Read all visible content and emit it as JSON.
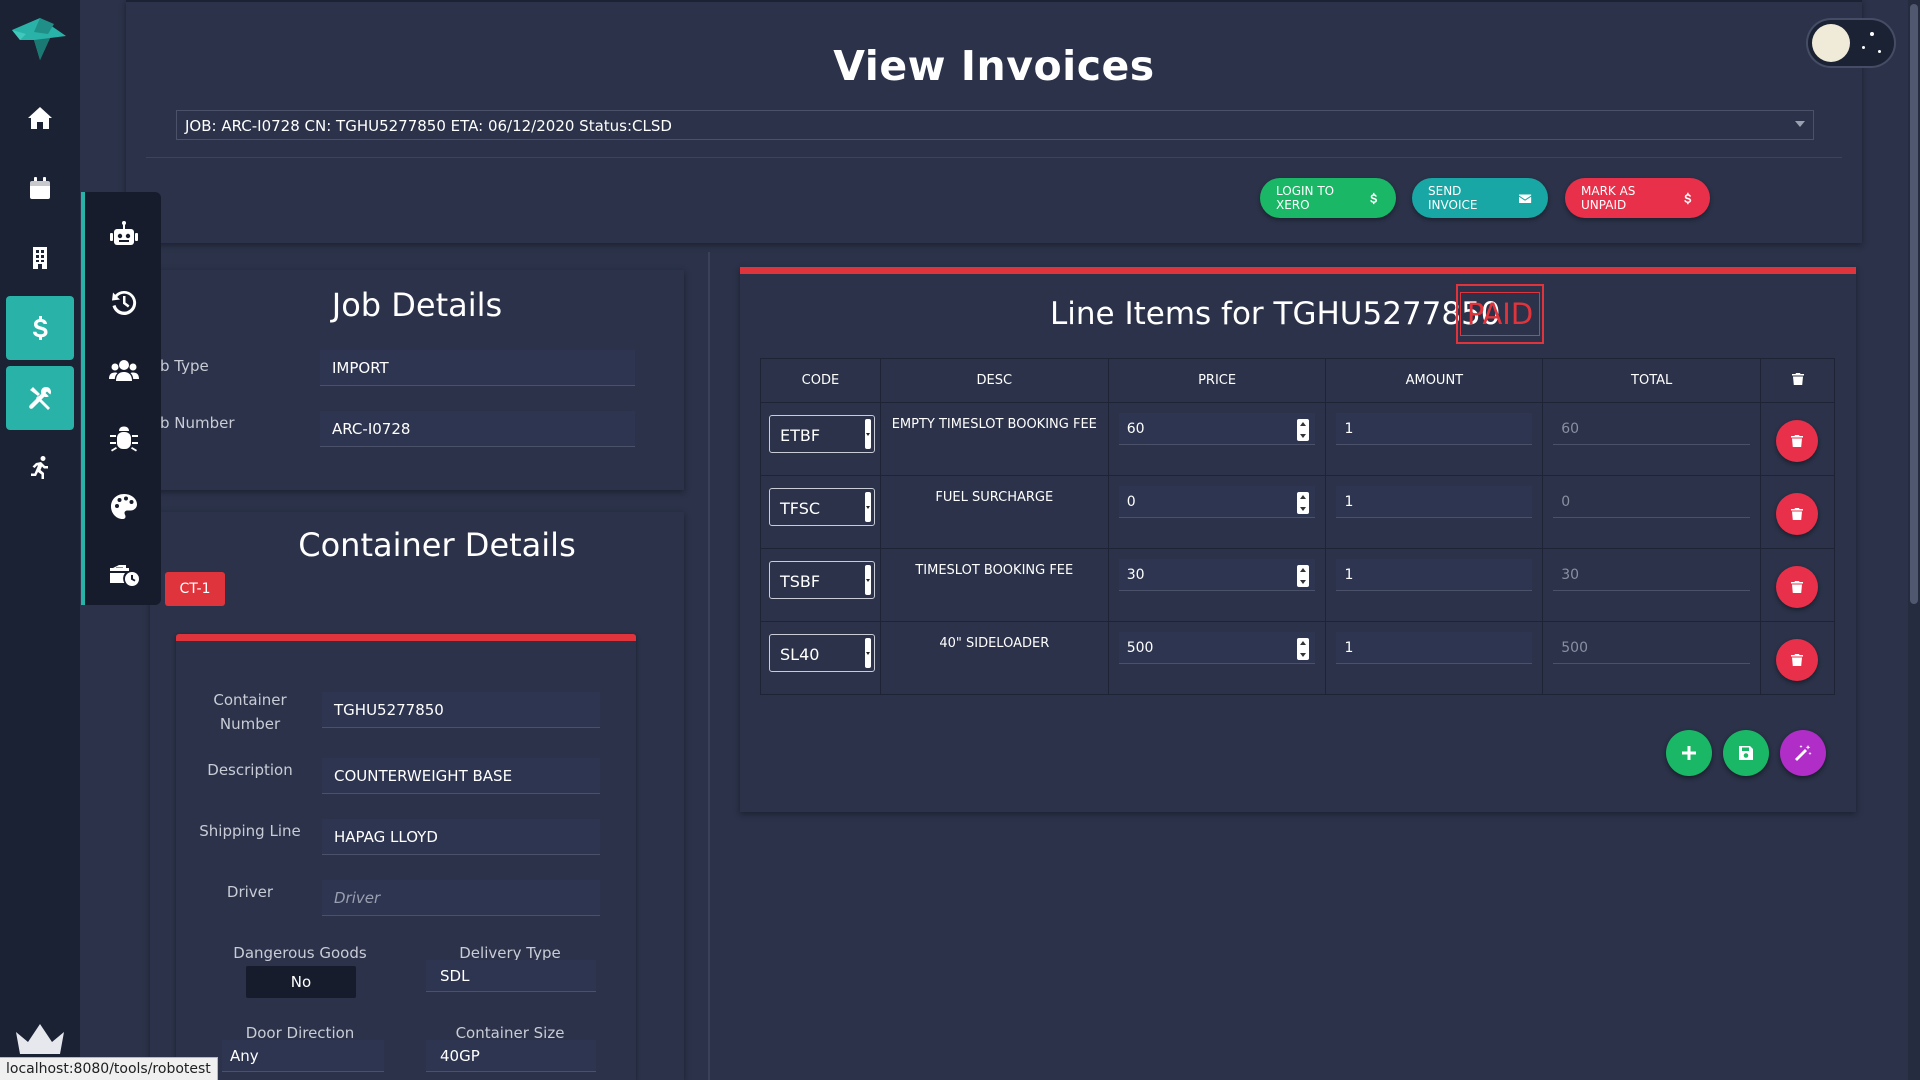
{
  "page": {
    "title": "View Invoices"
  },
  "job_select": {
    "value": "JOB: ARC-I0728 CN: TGHU5277850 ETA: 06/12/2020 Status:CLSD"
  },
  "actions": {
    "login_xero": "LOGIN TO XERO",
    "send_invoice": "SEND INVOICE",
    "mark_unpaid": "MARK AS UNPAID"
  },
  "job_details": {
    "title": "Job Details",
    "job_type_label": "b Type",
    "job_type_value": "IMPORT",
    "job_number_label": "b Number",
    "job_number_value": "ARC-I0728"
  },
  "container_details": {
    "title": "Container Details",
    "tab_label": "CT-1",
    "container_number_label": "Container Number",
    "container_number_value": "TGHU5277850",
    "description_label": "Description",
    "description_value": "COUNTERWEIGHT BASE",
    "shipping_line_label": "Shipping Line",
    "shipping_line_value": "HAPAG LLOYD",
    "driver_label": "Driver",
    "driver_placeholder": "Driver",
    "dangerous_goods_label": "Dangerous Goods",
    "dangerous_goods_value": "No",
    "delivery_type_label": "Delivery Type",
    "delivery_type_value": "SDL",
    "door_direction_label": "Door Direction",
    "door_direction_value": "Any",
    "container_size_label": "Container Size",
    "container_size_value": "40GP"
  },
  "line_items": {
    "title": "Line Items for TGHU5277850",
    "status_stamp": "PAID",
    "columns": [
      "CODE",
      "DESC",
      "PRICE",
      "AMOUNT",
      "TOTAL"
    ],
    "rows": [
      {
        "code": "ETBF",
        "desc": "EMPTY TIMESLOT BOOKING FEE",
        "price": "60",
        "amount": "1",
        "total": "60"
      },
      {
        "code": "TFSC",
        "desc": "FUEL SURCHARGE",
        "price": "0",
        "amount": "1",
        "total": "0"
      },
      {
        "code": "TSBF",
        "desc": "TIMESLOT BOOKING FEE",
        "price": "30",
        "amount": "1",
        "total": "30"
      },
      {
        "code": "SL40",
        "desc": "40\" SIDELOADER",
        "price": "500",
        "amount": "1",
        "total": "500"
      }
    ]
  },
  "status_bar": {
    "url": "localhost:8080/tools/robotest"
  },
  "colors": {
    "accent": "#29b3a8",
    "danger": "#e0343c",
    "success": "#1ab866",
    "magic": "#b02dc8",
    "background": "#2b3249"
  },
  "icons": {
    "rail": [
      "logo-bird-icon",
      "home-icon",
      "calendar-icon",
      "building-icon",
      "dollar-icon",
      "tools-icon",
      "running-icon",
      "crown-icon"
    ],
    "flyout": [
      "robot-icon",
      "history-icon",
      "users-icon",
      "bug-icon",
      "palette-icon",
      "business-time-icon"
    ]
  }
}
